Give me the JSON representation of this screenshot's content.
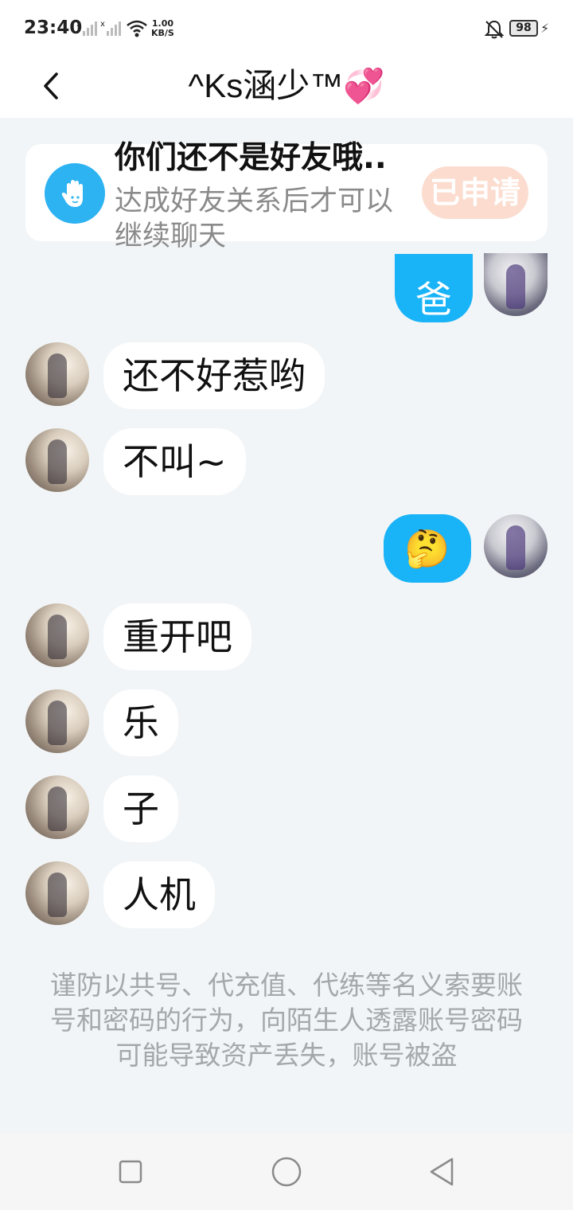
{
  "status_bar": {
    "time": "23:40",
    "net_speed_value": "1.00",
    "net_speed_unit": "KB/S",
    "battery": "98"
  },
  "chat": {
    "title": "^Ks涵少™💞",
    "friend_card": {
      "title": "你们还不是好友哦..",
      "subtitle": "达成好友关系后才可以继续聊天",
      "button": "已申请"
    },
    "messages": [
      {
        "side": "right",
        "text": "爸"
      },
      {
        "side": "left",
        "text": "还不好惹哟"
      },
      {
        "side": "left",
        "text": "不叫~"
      },
      {
        "side": "right",
        "text": "🤔"
      },
      {
        "side": "left",
        "text": "重开吧"
      },
      {
        "side": "left",
        "text": "乐"
      },
      {
        "side": "left",
        "text": "子"
      },
      {
        "side": "left",
        "text": "人机"
      }
    ],
    "notice": "谨防以共号、代充值、代练等名义索要账号和密码的行为，向陌生人透露账号密码可能导致资产丢失，账号被盗"
  },
  "colors": {
    "accent_blue": "#19b3f7",
    "applied_pink": "#fbdccf",
    "chat_bg": "#f2f5f7"
  },
  "icons": [
    "back-arrow-icon",
    "wave-hand-icon",
    "signal-icon",
    "wifi-icon",
    "bell-muted-icon",
    "battery-icon",
    "charging-icon",
    "nav-square-icon",
    "nav-circle-icon",
    "nav-triangle-icon"
  ]
}
